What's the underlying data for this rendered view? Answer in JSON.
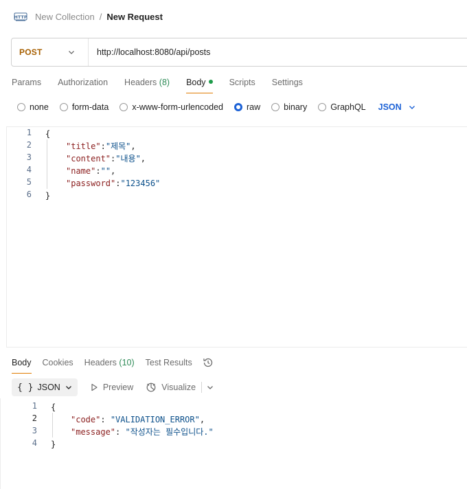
{
  "breadcrumb": {
    "parent": "New Collection",
    "separator": "/",
    "current": "New Request"
  },
  "request": {
    "method": "POST",
    "url": "http://localhost:8080/api/posts"
  },
  "request_tabs": [
    {
      "label": "Params"
    },
    {
      "label": "Authorization"
    },
    {
      "label": "Headers",
      "count": "(8)"
    },
    {
      "label": "Body",
      "active": true
    },
    {
      "label": "Scripts"
    },
    {
      "label": "Settings"
    }
  ],
  "body_types": [
    {
      "label": "none",
      "checked": false
    },
    {
      "label": "form-data",
      "checked": false
    },
    {
      "label": "x-www-form-urlencoded",
      "checked": false
    },
    {
      "label": "raw",
      "checked": true
    },
    {
      "label": "binary",
      "checked": false
    },
    {
      "label": "GraphQL",
      "checked": false
    }
  ],
  "body_format": "JSON",
  "request_body": {
    "line_numbers": [
      "1",
      "2",
      "3",
      "4",
      "5",
      "6"
    ],
    "open_brace": "{",
    "close_brace": "}",
    "fields": [
      {
        "key": "\"title\"",
        "value": "\"제목\"",
        "trail": ","
      },
      {
        "key": "\"content\"",
        "value": "\"내용\"",
        "trail": ","
      },
      {
        "key": "\"name\"",
        "value": "\"\"",
        "trail": ","
      },
      {
        "key": "\"password\"",
        "value": "\"123456\"",
        "trail": ""
      }
    ]
  },
  "response_tabs": [
    {
      "label": "Body",
      "active": true
    },
    {
      "label": "Cookies"
    },
    {
      "label": "Headers",
      "count": "(10)"
    },
    {
      "label": "Test Results"
    }
  ],
  "response_toolbar": {
    "format_braces": "{ }",
    "format": "JSON",
    "preview": "Preview",
    "visualize": "Visualize"
  },
  "response_body": {
    "line_numbers": [
      "1",
      "2",
      "3",
      "4"
    ],
    "open_brace": "{",
    "close_brace": "}",
    "fields": [
      {
        "key": "\"code\"",
        "value": "\"VALIDATION_ERROR\"",
        "trail": ","
      },
      {
        "key": "\"message\"",
        "value": "\"작성자는 필수입니다.\"",
        "trail": ""
      }
    ]
  },
  "colors": {
    "method": "#a75f00",
    "accent_blue": "#1d62d6",
    "active_tab_underline": "#e07b00",
    "count_green": "#2e8b57",
    "json_key": "#8a1d1d",
    "json_string": "#0b4f8a"
  }
}
